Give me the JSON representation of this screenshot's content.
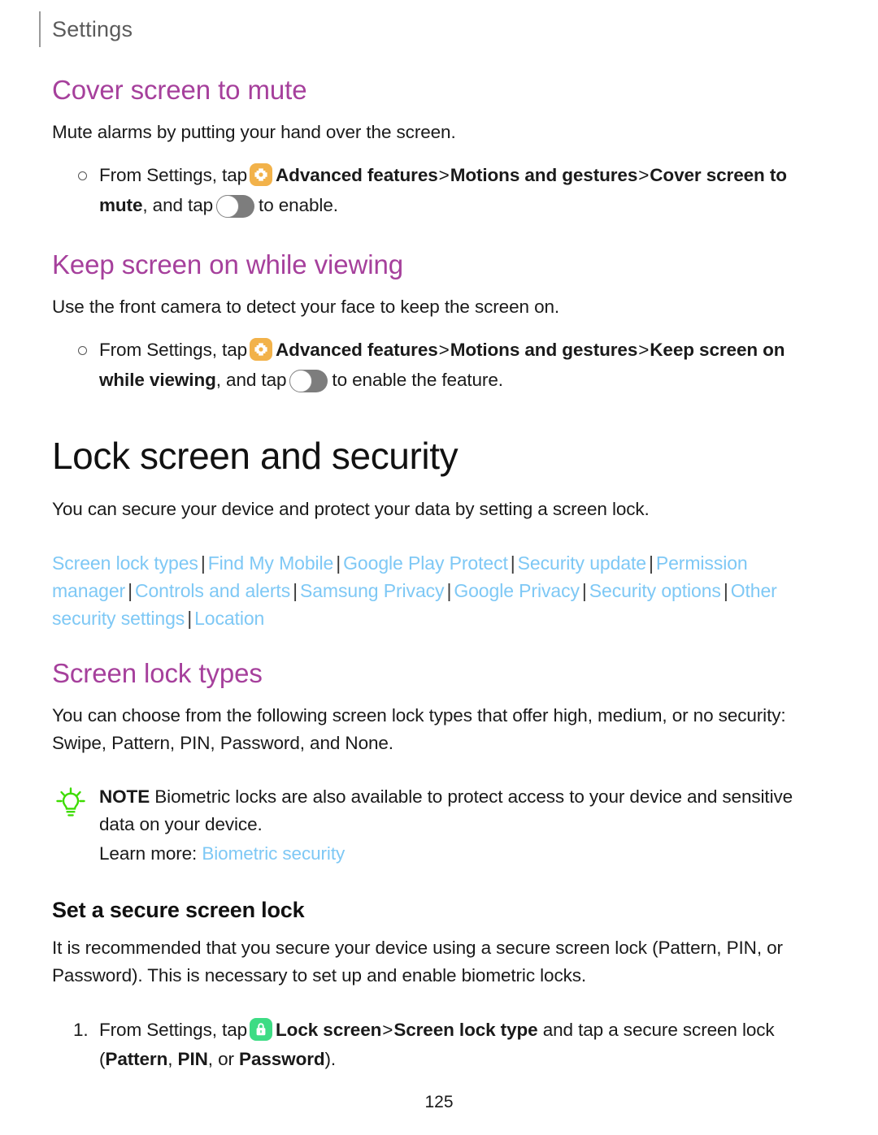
{
  "header": {
    "title": "Settings"
  },
  "page_number": "125",
  "colors": {
    "heading_magenta": "#a6409c",
    "link_blue": "#7ec8f5",
    "settings_icon_bg": "#f2b24a",
    "lock_icon_bg": "#3ddc84",
    "note_bulb_green": "#3ddc00",
    "toggle_track": "#7d7d7d",
    "body_text": "#1a1a1a",
    "header_gray": "#5b5b5b"
  },
  "sections": {
    "cover_screen_to_mute": {
      "heading": "Cover screen to mute",
      "intro": "Mute alarms by putting your hand over the screen.",
      "step": {
        "prefix": "From Settings, tap",
        "icon": "settings-icon",
        "path_1": "Advanced features",
        "chevron": ">",
        "path_2": "Motions and gestures",
        "path_3": "Cover screen to mute",
        "mid": ", and tap",
        "toggle": "toggle-switch-off",
        "suffix": "to enable."
      }
    },
    "keep_screen_on_while_viewing": {
      "heading": "Keep screen on while viewing",
      "intro": "Use the front camera to detect your face to keep the screen on.",
      "step": {
        "prefix": "From Settings, tap",
        "icon": "settings-icon",
        "path_1": "Advanced features",
        "chevron": ">",
        "path_2": "Motions and gestures",
        "path_3": "Keep screen on while viewing",
        "mid": ", and tap",
        "toggle": "toggle-switch-off",
        "suffix": "to enable the feature."
      }
    },
    "lock_screen_and_security": {
      "heading": "Lock screen and security",
      "intro": "You can secure your device and protect your data by setting a screen lock.",
      "links": [
        "Screen lock types",
        "Find My Mobile",
        "Google Play Protect",
        "Security update",
        "Permission manager",
        "Controls and alerts",
        "Samsung Privacy",
        "Google Privacy",
        "Security options",
        "Other security settings",
        "Location"
      ],
      "link_separator": "|"
    },
    "screen_lock_types": {
      "heading": "Screen lock types",
      "intro": "You can choose from the following screen lock types that offer high, medium, or no security: Swipe, Pattern, PIN, Password, and None.",
      "note": {
        "icon": "lightbulb-icon",
        "label": "NOTE",
        "text": "Biometric locks are also available to protect access to your device and sensitive data on your device.",
        "learn_more_label": "Learn more:",
        "learn_more_link": "Biometric security"
      }
    },
    "set_a_secure_screen_lock": {
      "heading": "Set a secure screen lock",
      "intro": "It is recommended that you secure your device using a secure screen lock (Pattern, PIN, or Password). This is necessary to set up and enable biometric locks.",
      "step": {
        "prefix": "From Settings, tap",
        "icon": "lock-icon",
        "path_1": "Lock screen",
        "chevron": ">",
        "path_2": "Screen lock type",
        "mid": "and tap a secure screen lock (",
        "opt_1": "Pattern",
        "opt_sep_1": ", ",
        "opt_2": "PIN",
        "opt_sep_2": ", or ",
        "opt_3": "Password",
        "suffix": ")."
      }
    }
  }
}
